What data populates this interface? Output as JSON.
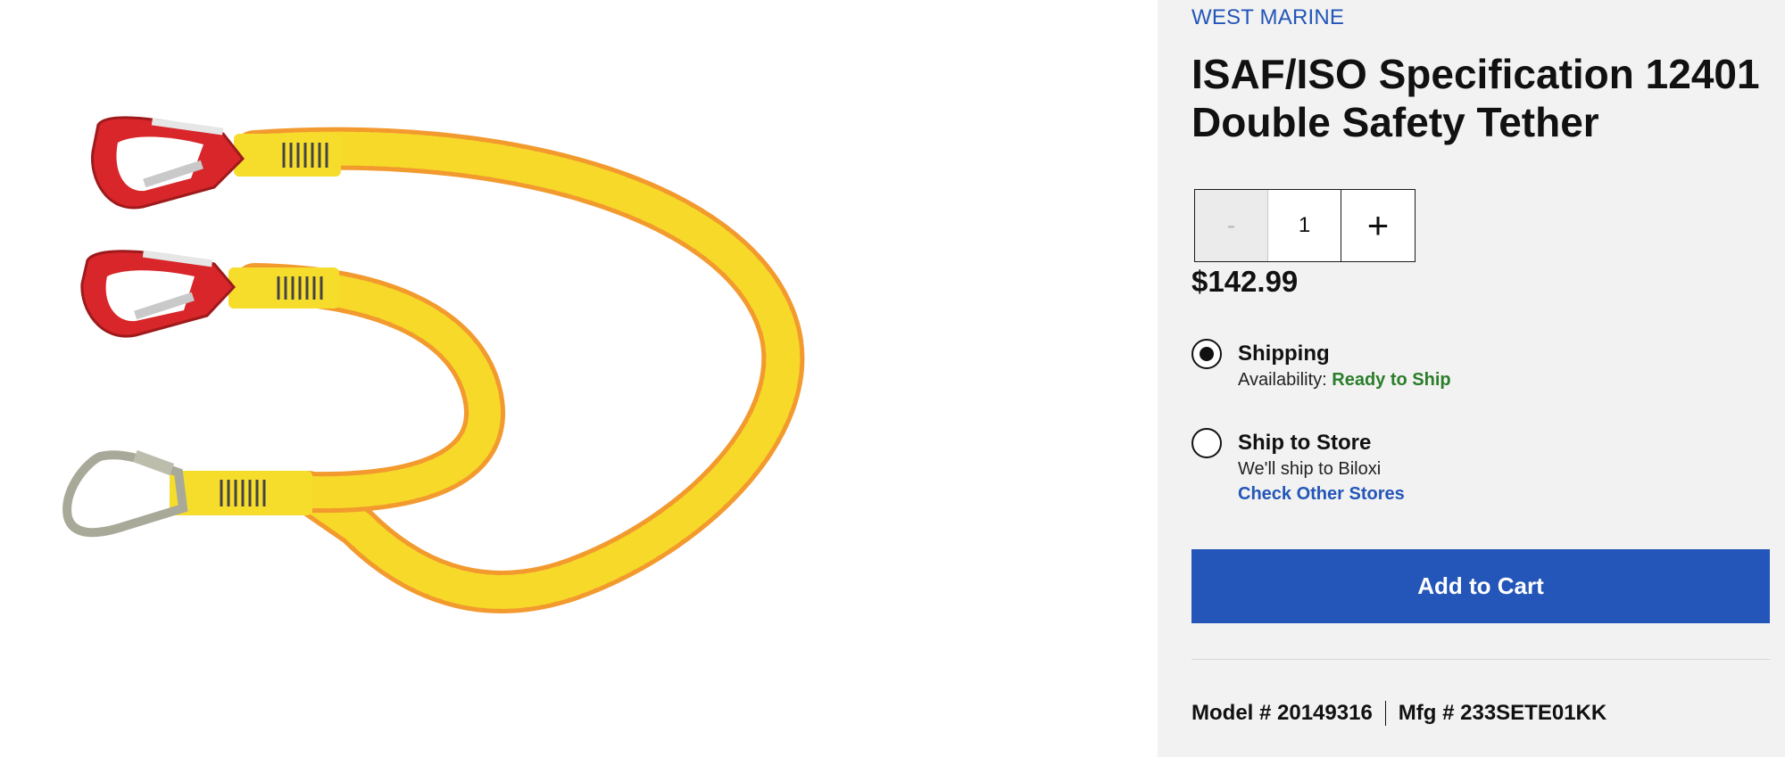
{
  "product": {
    "brand": "WEST MARINE",
    "title": "ISAF/ISO Specification 12401 Double Safety Tether",
    "image_alt": "Yellow double safety tether with two red carabiners and a silver snap hook",
    "price": "$142.99"
  },
  "quantity": {
    "minus_label": "-",
    "value": "1",
    "plus_label": "+"
  },
  "fulfillment": {
    "shipping": {
      "label": "Shipping",
      "availability_prefix": "Availability:",
      "availability_status": "Ready to Ship",
      "selected": true
    },
    "ship_to_store": {
      "label": "Ship to Store",
      "subtext": "We'll ship to Biloxi",
      "link": "Check Other Stores",
      "selected": false
    }
  },
  "actions": {
    "add_to_cart": "Add to Cart"
  },
  "identifiers": {
    "model": "Model # 20149316",
    "mfg": "Mfg # 233SETE01KK"
  },
  "colors": {
    "brand_blue": "#2356b8",
    "availability_green": "#2a7d2a",
    "panel_bg": "#f2f2f2",
    "tether_yellow": "#f7d92a",
    "carabiner_red": "#d8262a"
  }
}
